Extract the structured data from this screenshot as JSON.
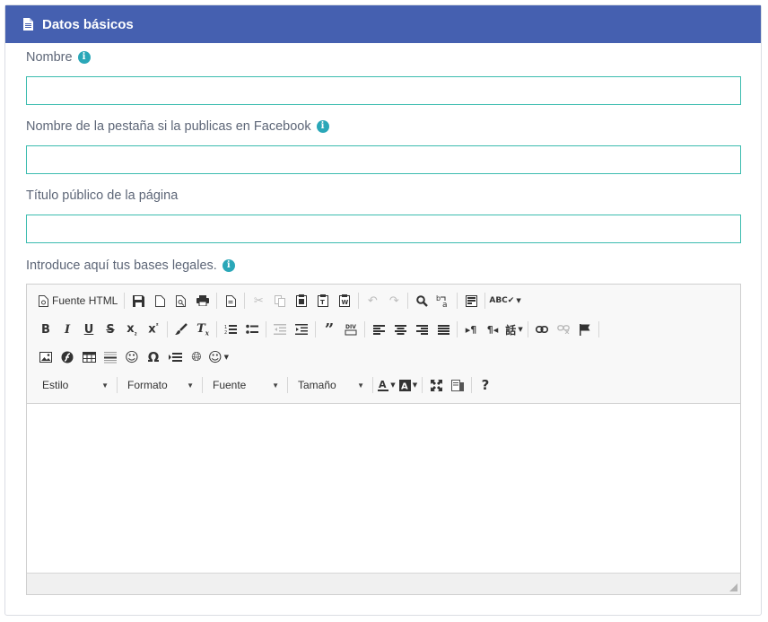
{
  "header": {
    "title": "Datos básicos",
    "icon": "document-icon"
  },
  "fields": [
    {
      "label": "Nombre",
      "has_info": true,
      "value": ""
    },
    {
      "label": "Nombre de la pestaña si la publicas en Facebook",
      "has_info": true,
      "value": ""
    },
    {
      "label": "Título público de la página",
      "has_info": false,
      "value": ""
    }
  ],
  "editor": {
    "label": "Introduce aquí tus bases legales.",
    "source_label": "Fuente HTML",
    "combos": {
      "style": "Estilo",
      "format": "Formato",
      "font": "Fuente",
      "size": "Tamaño"
    }
  },
  "colors": {
    "header_bg": "#4560b0",
    "input_border": "#3cbcaf",
    "info_icon": "#2aa7b8",
    "label_text": "#5d6677"
  },
  "info_glyph": "i"
}
